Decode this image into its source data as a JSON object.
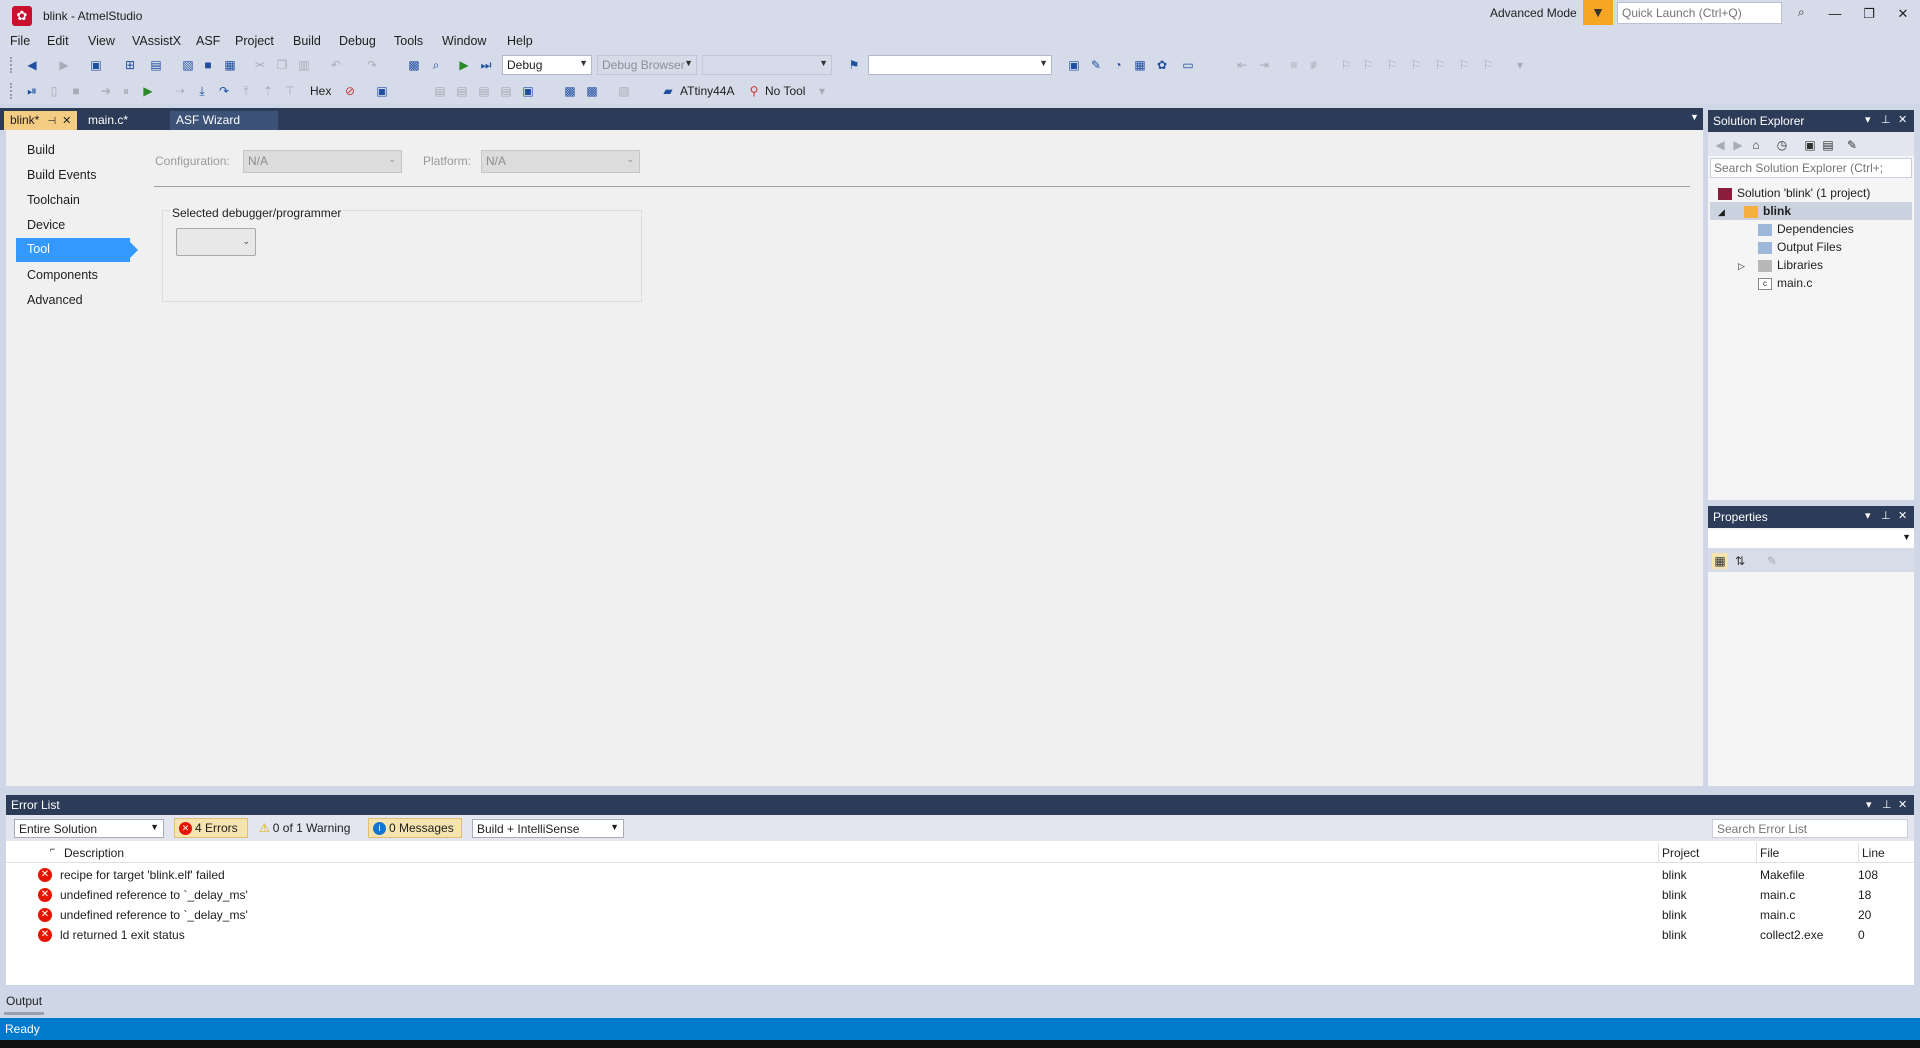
{
  "window": {
    "title": "blink - AtmelStudio",
    "mode": "Advanced Mode",
    "quick_launch_placeholder": "Quick Launch (Ctrl+Q)"
  },
  "menu": [
    "File",
    "Edit",
    "View",
    "VAssistX",
    "ASF",
    "Project",
    "Build",
    "Debug",
    "Tools",
    "Window",
    "Help"
  ],
  "toolbar": {
    "config": "Debug",
    "debug_browser": "Debug Browser",
    "hex_label": "Hex",
    "device": "ATtiny44A",
    "tool": "No Tool"
  },
  "doc_tabs": [
    {
      "label": "blink*"
    },
    {
      "label": "main.c*"
    },
    {
      "label": "ASF Wizard"
    }
  ],
  "project_nav": [
    "Build",
    "Build Events",
    "Toolchain",
    "Device",
    "Tool",
    "Components",
    "Advanced"
  ],
  "config": {
    "configuration_label": "Configuration:",
    "configuration_value": "N/A",
    "platform_label": "Platform:",
    "platform_value": "N/A"
  },
  "debugger": {
    "group_label": "Selected debugger/programmer",
    "value": ""
  },
  "solution_explorer": {
    "title": "Solution Explorer",
    "search_placeholder": "Search Solution Explorer (Ctrl+;",
    "items": [
      {
        "label": "Solution 'blink' (1 project)"
      },
      {
        "label": "blink"
      },
      {
        "label": "Dependencies"
      },
      {
        "label": "Output Files"
      },
      {
        "label": "Libraries"
      },
      {
        "label": "main.c"
      }
    ]
  },
  "properties": {
    "title": "Properties"
  },
  "error_list": {
    "title": "Error List",
    "scope": "Entire Solution",
    "errors_filter": "4 Errors",
    "warnings_filter": "0 of 1 Warning",
    "messages_filter": "0 Messages",
    "build_filter": "Build + IntelliSense",
    "search_placeholder": "Search Error List",
    "columns": {
      "description": "Description",
      "project": "Project",
      "file": "File",
      "line": "Line"
    },
    "rows": [
      {
        "description": "recipe for target 'blink.elf' failed",
        "project": "blink",
        "file": "Makefile",
        "line": "108"
      },
      {
        "description": "undefined reference to `_delay_ms'",
        "project": "blink",
        "file": "main.c",
        "line": "18"
      },
      {
        "description": "undefined reference to `_delay_ms'",
        "project": "blink",
        "file": "main.c",
        "line": "20"
      },
      {
        "description": "ld returned 1 exit status",
        "project": "blink",
        "file": "collect2.exe",
        "line": "0"
      }
    ]
  },
  "output_tab": "Output",
  "status": "Ready",
  "colors": {
    "accent": "#007acc",
    "active_tab": "#f5cc84",
    "selection": "#3399ff",
    "error": "#e51400",
    "panel_header": "#2b3b58"
  }
}
